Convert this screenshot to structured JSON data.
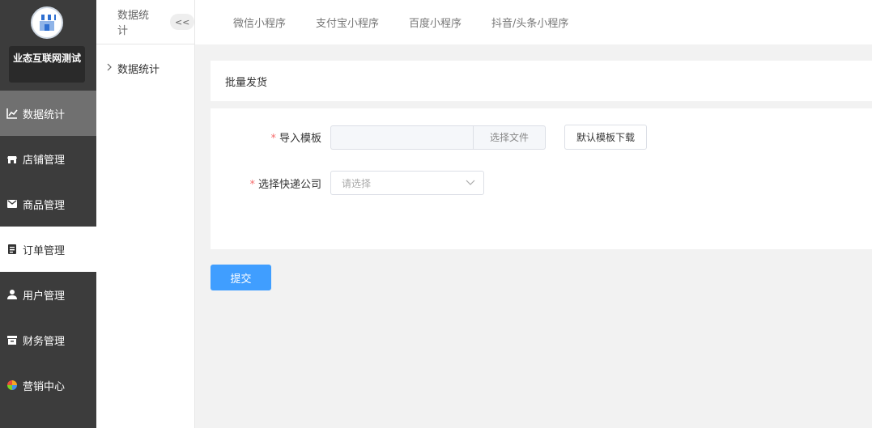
{
  "sidebar": {
    "shop_name": "业态互联网测试",
    "items": [
      {
        "label": "数据统计",
        "icon": "line-chart-icon",
        "state": "hover"
      },
      {
        "label": "店铺管理",
        "icon": "store-icon",
        "state": "normal"
      },
      {
        "label": "商品管理",
        "icon": "mail-icon",
        "state": "normal"
      },
      {
        "label": "订单管理",
        "icon": "clipboard-icon",
        "state": "selected"
      },
      {
        "label": "用户管理",
        "icon": "user-icon",
        "state": "normal"
      },
      {
        "label": "财务管理",
        "icon": "archive-icon",
        "state": "normal"
      },
      {
        "label": "营销中心",
        "icon": "pinwheel-icon",
        "state": "normal"
      }
    ]
  },
  "subnav": {
    "header": "数据统计",
    "collapse_label": "<<",
    "items": [
      {
        "label": "数据统计"
      }
    ]
  },
  "topbar": {
    "tabs": [
      "微信小程序",
      "支付宝小程序",
      "百度小程序",
      "抖音/头条小程序"
    ]
  },
  "form": {
    "title": "批量发货",
    "template_label": "导入模板",
    "choose_file": "选择文件",
    "download_template": "默认模板下载",
    "courier_label": "选择快递公司",
    "courier_placeholder": "请选择",
    "required_mark": "*",
    "submit": "提交"
  },
  "colors": {
    "sidebar_bg": "#3c3c3c",
    "primary": "#409eff",
    "required": "#f56c6c"
  }
}
